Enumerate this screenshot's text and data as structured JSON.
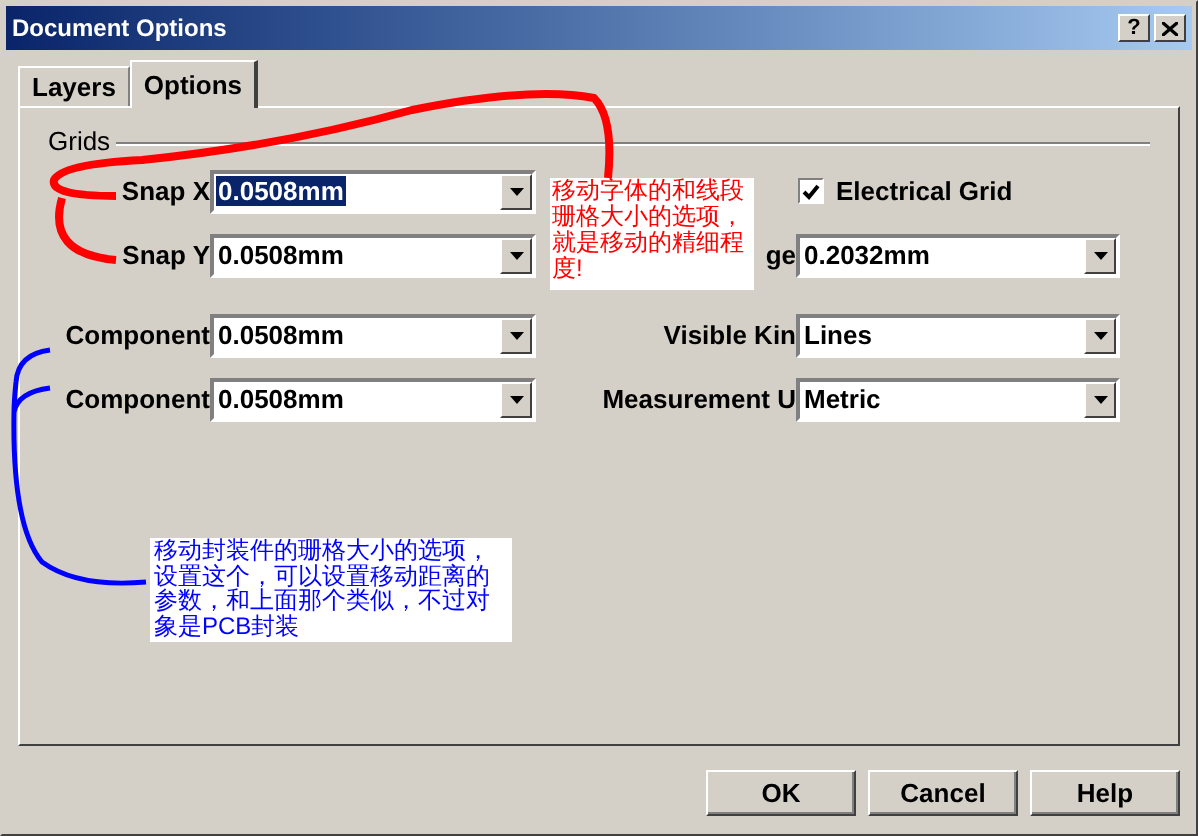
{
  "window": {
    "title": "Document Options",
    "help_button": "?"
  },
  "tabs": [
    {
      "label": "Layers",
      "selected": false
    },
    {
      "label": "Options",
      "selected": true
    }
  ],
  "group": {
    "title": "Grids",
    "left_fields": [
      {
        "label": "Snap X",
        "value": "0.0508mm",
        "highlighted": true
      },
      {
        "label": "Snap Y",
        "value": "0.0508mm",
        "highlighted": false
      },
      {
        "label": "Component",
        "value": "0.0508mm",
        "highlighted": false
      },
      {
        "label": "Component",
        "value": "0.0508mm",
        "highlighted": false
      }
    ],
    "right_fields": [
      {
        "kind": "checkbox",
        "label": "Electrical Grid",
        "checked": true
      },
      {
        "kind": "combo",
        "label": "ge",
        "value": "0.2032mm"
      },
      {
        "kind": "combo",
        "label": "Visible Kin",
        "value": "Lines"
      },
      {
        "kind": "combo",
        "label": "Measurement U",
        "value": "Metric"
      }
    ]
  },
  "buttons": [
    "OK",
    "Cancel",
    "Help"
  ],
  "annotations": [
    {
      "text": "移动字体的和线段珊格大小的选项，就是移动的精细程度!",
      "color": "#ff0000"
    },
    {
      "text": "移动封装件的珊格大小的选项，设置这个，可以设置移动距离的参数，和上面那个类似，不过对象是PCB封装",
      "color": "#0000ff"
    }
  ]
}
